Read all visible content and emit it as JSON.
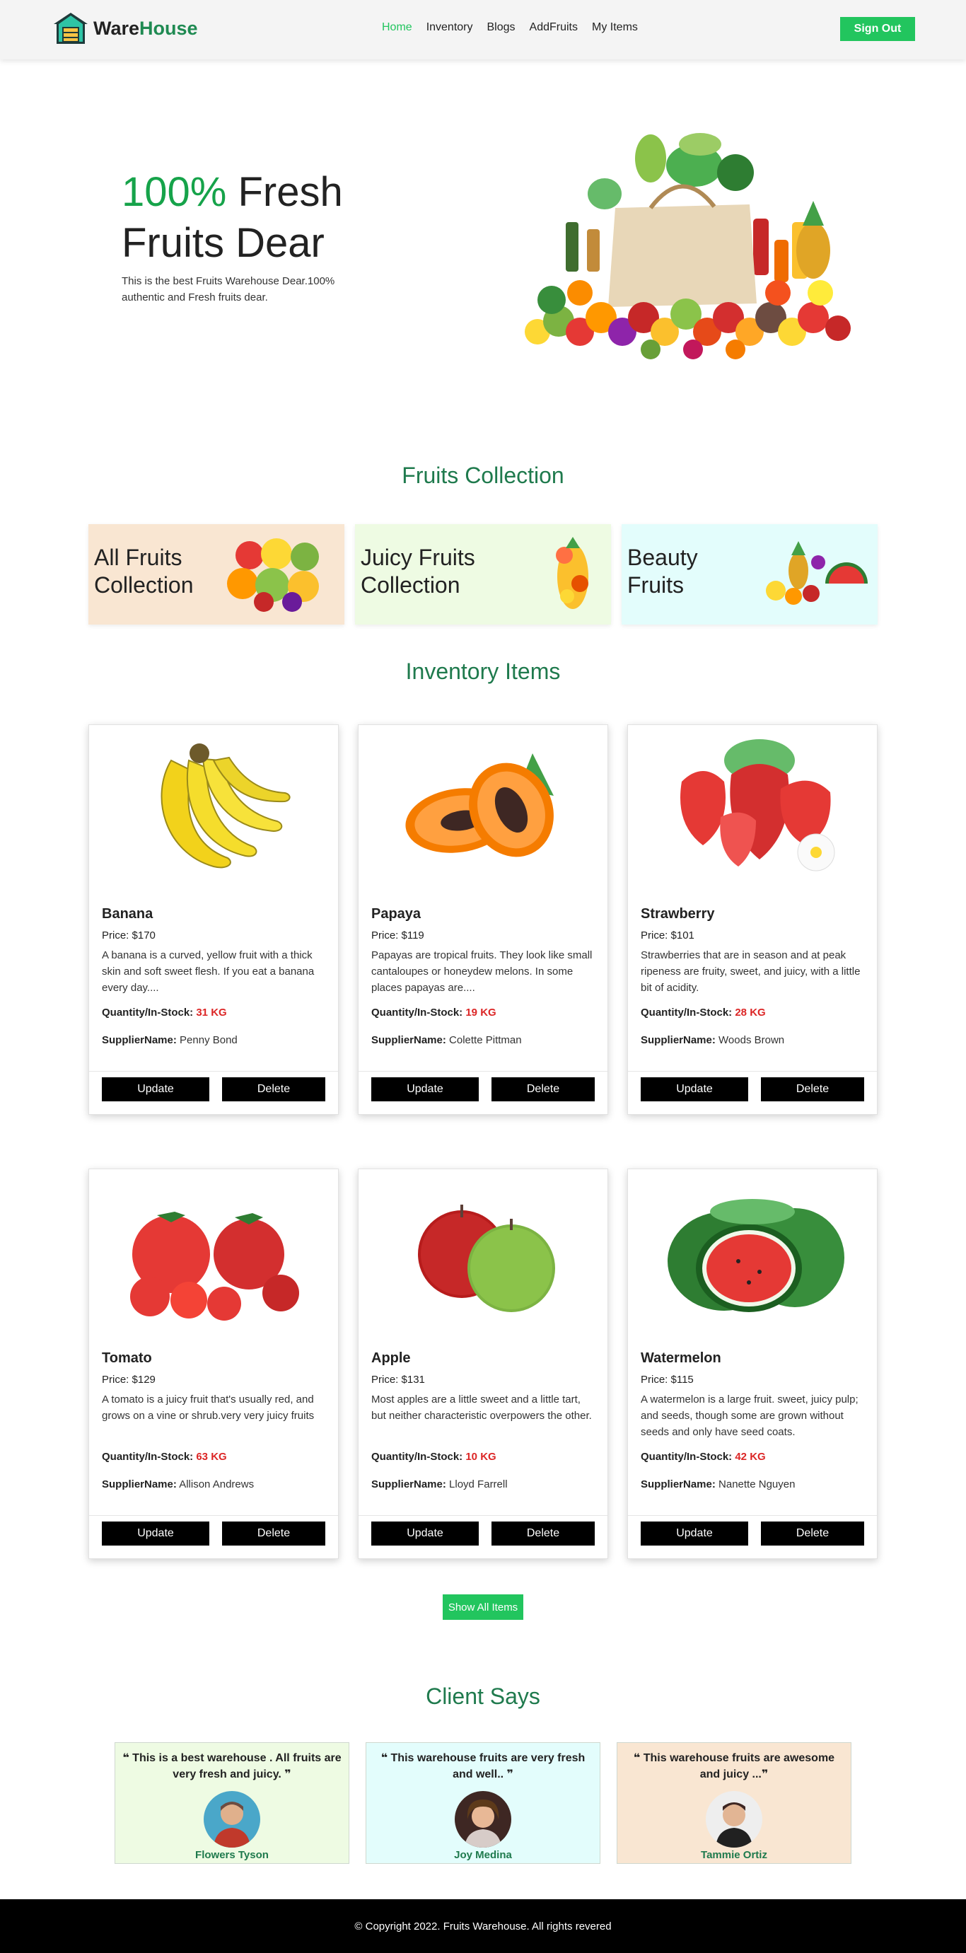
{
  "brand": {
    "name_part1": "Ware",
    "name_part2": "House"
  },
  "nav": {
    "links": [
      "Home",
      "Inventory",
      "Blogs",
      "AddFruits",
      "My Items"
    ],
    "signout_label": "Sign Out"
  },
  "hero": {
    "title_highlight": "100%",
    "title_rest1": " Fresh",
    "title_line2": "Fruits Dear",
    "subtitle": "This is the best Fruits Warehouse Dear.100% authentic and Fresh fruits dear."
  },
  "collection": {
    "title": "Fruits Collection",
    "cards": [
      {
        "line1": "All Fruits",
        "line2": "Collection",
        "bg": "#f9e6d2"
      },
      {
        "line1": "Juicy Fruits",
        "line2": "Collection",
        "bg": "#eefbe3"
      },
      {
        "line1": "Beauty",
        "line2": "Fruits",
        "bg": "#e3fdfc"
      }
    ]
  },
  "inventory": {
    "title": "Inventory Items",
    "labels": {
      "price_prefix": "Price: ",
      "qty_label": "Quantity/In-Stock:",
      "supplier_label": "SupplierName:",
      "update": "Update",
      "delete": "Delete"
    },
    "items": [
      {
        "name": "Banana",
        "price": "$170",
        "desc": "A banana is a curved, yellow fruit with a thick skin and soft sweet flesh. If you eat a banana every day....",
        "qty": "31 KG",
        "supplier": "Penny Bond",
        "icon": "banana-image"
      },
      {
        "name": "Papaya",
        "price": "$119",
        "desc": "Papayas are tropical fruits. They look like small cantaloupes or honeydew melons. In some places papayas are....",
        "qty": "19 KG",
        "supplier": "Colette Pittman",
        "icon": "papaya-image"
      },
      {
        "name": "Strawberry",
        "price": "$101",
        "desc": "Strawberries that are in season and at peak ripeness are fruity, sweet, and juicy, with a little bit of acidity.",
        "qty": "28 KG",
        "supplier": "Woods Brown",
        "icon": "strawberry-image"
      },
      {
        "name": "Tomato",
        "price": "$129",
        "desc": "A tomato is a juicy fruit that's usually red, and grows on a vine or shrub.very very juicy fruits",
        "qty": "63 KG",
        "supplier": "Allison Andrews",
        "icon": "tomato-image"
      },
      {
        "name": "Apple",
        "price": "$131",
        "desc": "Most apples are a little sweet and a little tart, but neither characteristic overpowers the other.",
        "qty": "10 KG",
        "supplier": "Lloyd Farrell",
        "icon": "apple-image"
      },
      {
        "name": "Watermelon",
        "price": "$115",
        "desc": "A watermelon is a large fruit. sweet, juicy pulp; and seeds, though some are grown without seeds and only have seed coats.",
        "qty": "42 KG",
        "supplier": "Nanette Nguyen",
        "icon": "watermelon-image"
      }
    ],
    "show_all_label": "Show All Items"
  },
  "clients": {
    "title": "Client Says",
    "items": [
      {
        "quote": "❝ This is a best warehouse . All fruits are very fresh and juicy. ❞",
        "name": "Flowers Tyson",
        "bg": "#eefbe3"
      },
      {
        "quote": "❝ This warehouse fruits are very fresh and well.. ❞",
        "name": "Joy Medina",
        "bg": "#e3fdfc"
      },
      {
        "quote": "❝ This warehouse fruits are awesome and juicy ...❞",
        "name": "Tammie Ortiz",
        "bg": "#f9e6d2"
      }
    ]
  },
  "footer": {
    "text": "© Copyright 2022. Fruits Warehouse. All rights revered"
  },
  "colors": {
    "accent": "#22c55e",
    "heading": "#1f7a4d",
    "stock": "#dc2626"
  }
}
